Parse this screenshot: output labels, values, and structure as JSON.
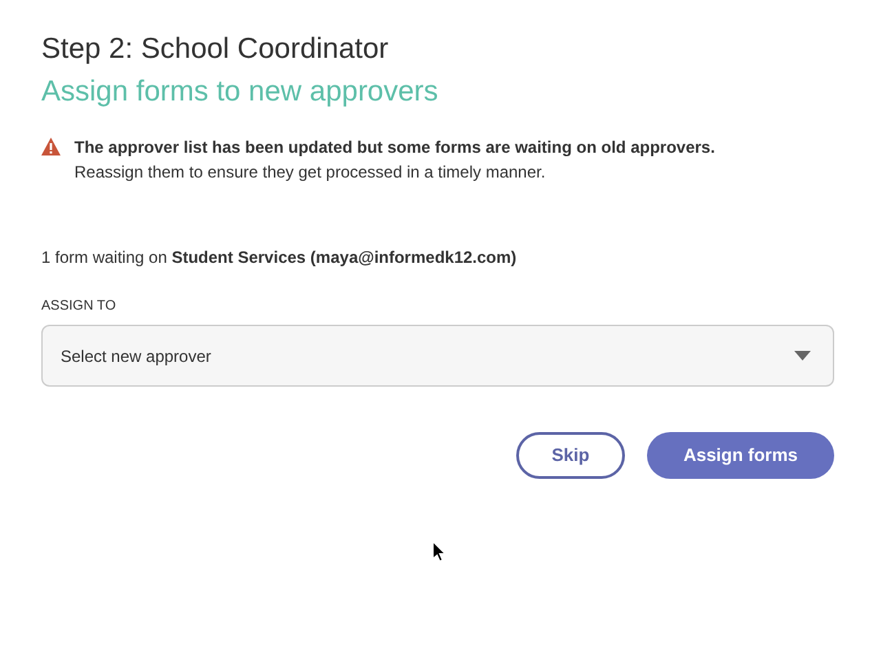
{
  "dialog": {
    "title": "Step 2: School Coordinator",
    "subtitle": "Assign forms to new approvers"
  },
  "warning": {
    "headline": "The approver list has been updated but some forms are waiting on old approvers.",
    "detail": "Reassign them to ensure they get processed in a timely manner."
  },
  "waiting_note": "1 form waiting on **Student Services (maya@informedk12.com)**",
  "assign_field": {
    "label": "ASSIGN TO",
    "placeholder": "Select new approver"
  },
  "buttons": [
    {
      "label": "Skip",
      "kind": "secondary"
    },
    {
      "label": "Assign forms",
      "kind": "primary"
    }
  ]
}
